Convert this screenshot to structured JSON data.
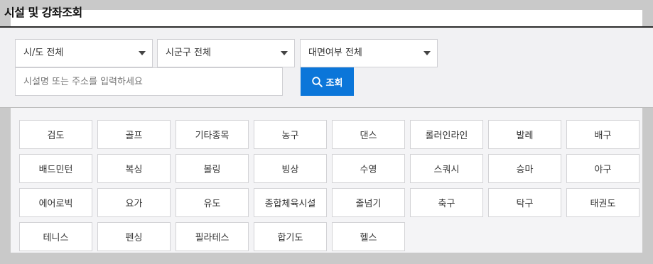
{
  "header": {
    "title": "시설 및 강좌조회"
  },
  "filters": {
    "region_select": "시/도 전체",
    "district_select": "시군구 전체",
    "mode_select": "대면여부 전체",
    "search_placeholder": "시설명 또는 주소를 입력하세요",
    "search_button": "조회"
  },
  "categories": [
    "검도",
    "골프",
    "기타종목",
    "농구",
    "댄스",
    "롤러인라인",
    "발레",
    "배구",
    "배드민턴",
    "복싱",
    "볼링",
    "빙상",
    "수영",
    "스쿼시",
    "승마",
    "야구",
    "에어로빅",
    "요가",
    "유도",
    "종합체육시설",
    "줄넘기",
    "축구",
    "탁구",
    "태권도",
    "테니스",
    "펜싱",
    "필라테스",
    "합기도",
    "헬스"
  ],
  "colors": {
    "accent": "#0b76d9",
    "panel_bg": "#f4f4f6",
    "frame_bg": "#c9c9c9"
  }
}
